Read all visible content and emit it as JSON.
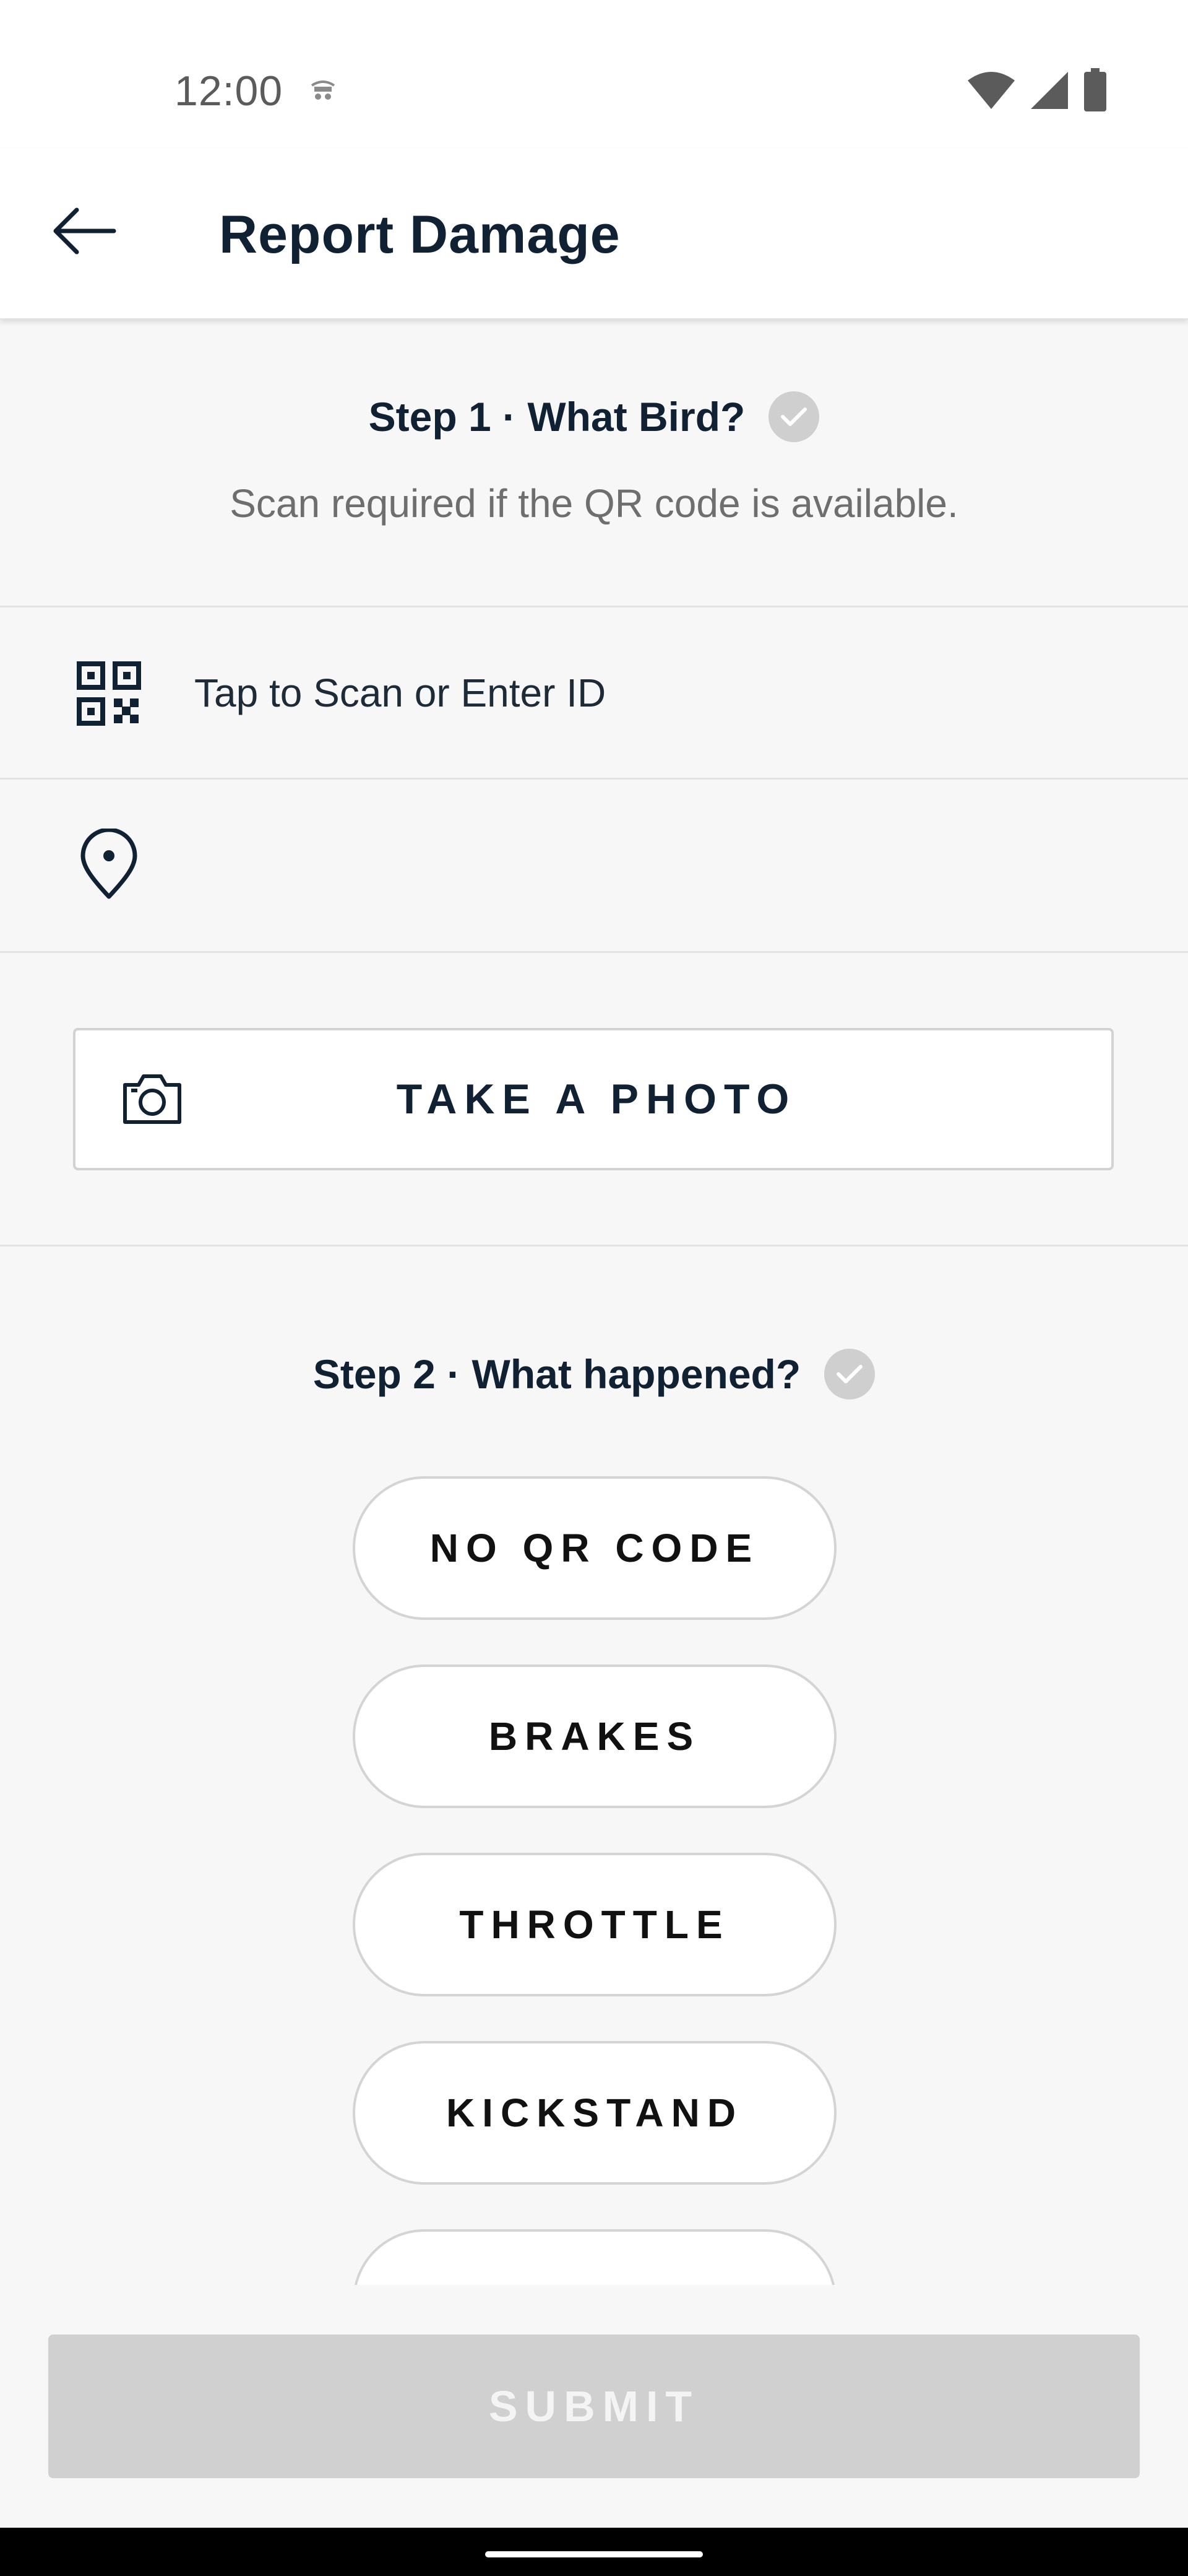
{
  "status_bar": {
    "time": "12:00",
    "icons": [
      "bird-app-icon",
      "wifi-icon",
      "signal-icon",
      "battery-icon"
    ]
  },
  "app_bar": {
    "title": "Report Damage",
    "back_icon": "arrow-left-icon"
  },
  "step1": {
    "title": "Step 1 · What Bird?",
    "subtitle": "Scan required if the QR code is available.",
    "scan_row_label": "Tap to Scan or Enter ID",
    "location_row_label": "",
    "photo_button_label": "TAKE A PHOTO"
  },
  "step2": {
    "title": "Step 2 · What happened?",
    "options": [
      "NO QR CODE",
      "BRAKES",
      "THROTTLE",
      "KICKSTAND",
      ""
    ]
  },
  "submit_label": "SUBMIT",
  "colors": {
    "primary_text": "#0f2133",
    "background": "#f7f7f7",
    "check_badge": "#cfcfcf",
    "submit_disabled": "#d0d0d0"
  }
}
